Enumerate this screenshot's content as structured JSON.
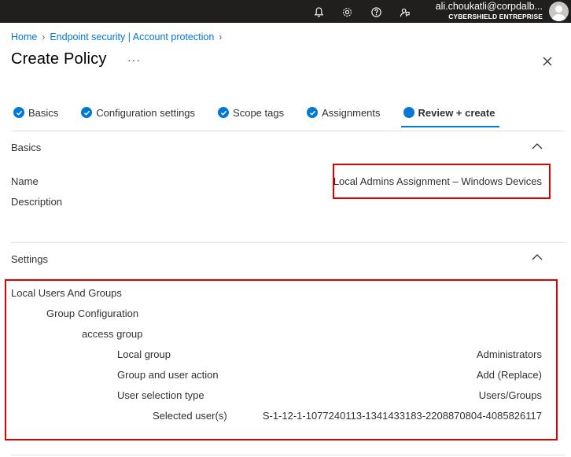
{
  "topbar": {
    "user": "ali.choukatli@corpdalb...",
    "tenant": "CYBERSHIELD ENTREPRISE",
    "icons": [
      "bell-icon",
      "gear-icon",
      "help-icon",
      "feedback-icon"
    ]
  },
  "breadcrumb": {
    "home": "Home",
    "current": "Endpoint security | Account protection"
  },
  "page": {
    "title": "Create Policy",
    "more": "···"
  },
  "tabs": [
    {
      "label": "Basics",
      "state": "done"
    },
    {
      "label": "Configuration settings",
      "state": "done"
    },
    {
      "label": "Scope tags",
      "state": "done"
    },
    {
      "label": "Assignments",
      "state": "done"
    },
    {
      "label": "Review + create",
      "state": "active"
    }
  ],
  "basics": {
    "title": "Basics",
    "name_label": "Name",
    "name_value": "Local Admins Assignment – Windows Devices",
    "description_label": "Description"
  },
  "settings": {
    "title": "Settings",
    "level1": "Local Users And Groups",
    "level2": "Group Configuration",
    "level3": "access group",
    "local_group_label": "Local group",
    "local_group_value": "Administrators",
    "action_label": "Group and user action",
    "action_value": "Add (Replace)",
    "selection_type_label": "User selection type",
    "selection_type_value": "Users/Groups",
    "selected_users_label": "Selected user(s)",
    "selected_users_value": "S-1-12-1-1077240113-1341433183-2208870804-4085826117"
  },
  "colors": {
    "topbar": "#201f1e",
    "accent": "#0078d4",
    "highlight": "#e00000"
  }
}
